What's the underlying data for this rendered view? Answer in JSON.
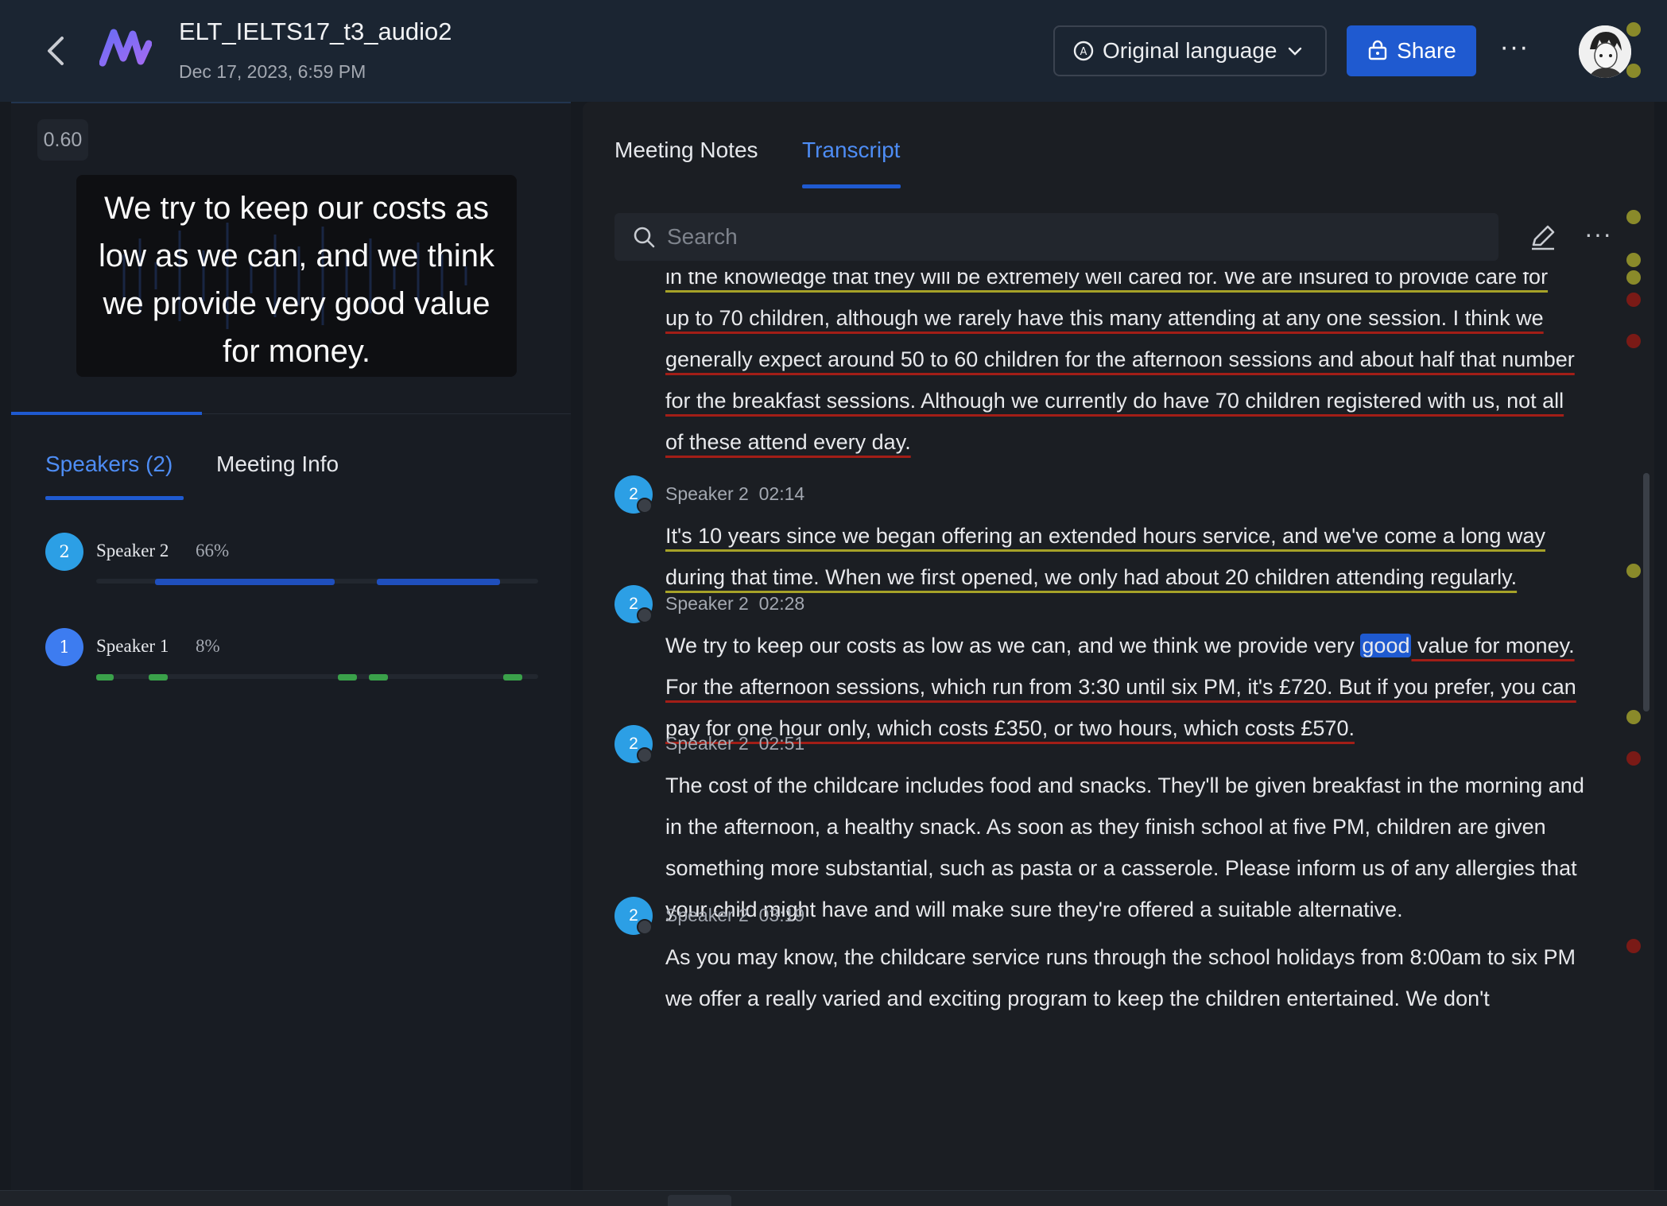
{
  "header": {
    "title": "ELT_IELTS17_t3_audio2",
    "date": "Dec 17, 2023, 6:59 PM",
    "language_label": "Original language",
    "share_label": "Share",
    "more_label": "···"
  },
  "player": {
    "speed": "0.60",
    "caption": "We try to keep our costs as low as we can, and we think we provide very good value for money."
  },
  "left_tabs": [
    "Speakers (2)",
    "Meeting Info"
  ],
  "speakers": [
    {
      "badge": "2",
      "name": "Speaker 2",
      "percent": "66%",
      "color": "#2c9fe5"
    },
    {
      "badge": "1",
      "name": "Speaker 1",
      "percent": "8%",
      "color": "#3d7cf0"
    }
  ],
  "right_tabs": [
    "Meeting Notes",
    "Transcript"
  ],
  "search": {
    "placeholder": "Search"
  },
  "transcript": {
    "partial_first_line": "in the knowledge that they will be extremely well cared for. We are insured to provide care for",
    "intro_paragraph": "up to 70 children, although we rarely have this many attending at any one session. I think we generally expect around 50 to 60 children for the afternoon sessions and about half that number for the breakfast sessions. Although we currently do have 70 children registered with us, not all of these attend every day.",
    "entries": [
      {
        "badge": "2",
        "speaker": "Speaker 2",
        "time": "02:14",
        "text": "It's 10 years since we began offering an extended hours service, and we've come a long way during that time. When we first opened, we only had about 20 children attending regularly."
      },
      {
        "badge": "2",
        "speaker": "Speaker 2",
        "time": "02:28",
        "text_before": "We try to keep our costs as low as we can, and we think we provide very ",
        "highlight": "good",
        "text_after": " value for money. For the afternoon sessions, which run from 3:30 until six PM, it's £720. But if you prefer, you can pay for one hour only, which costs £350, or two hours, which costs £570."
      },
      {
        "badge": "2",
        "speaker": "Speaker 2",
        "time": "02:51",
        "text": "The cost of the childcare includes food and snacks. They'll be given breakfast in the morning and in the afternoon, a healthy snack. As soon as they finish school at five PM, children are given something more substantial, such as pasta or a casserole. Please inform us of any allergies that your child might have and will make sure they're offered a suitable alternative."
      },
      {
        "badge": "2",
        "speaker": "Speaker 2",
        "time": "03:19",
        "text": "As you may know, the childcare service runs through the school holidays from 8:00am to six PM we offer a really varied and exciting program to keep the children entertained. We don't"
      }
    ]
  },
  "colors": {
    "accent": "#1f5ad0",
    "accent_text": "#4e8df5",
    "underline_red": "#a31e17",
    "underline_yellow": "#a6a228",
    "green_segment": "#3aa14a"
  }
}
